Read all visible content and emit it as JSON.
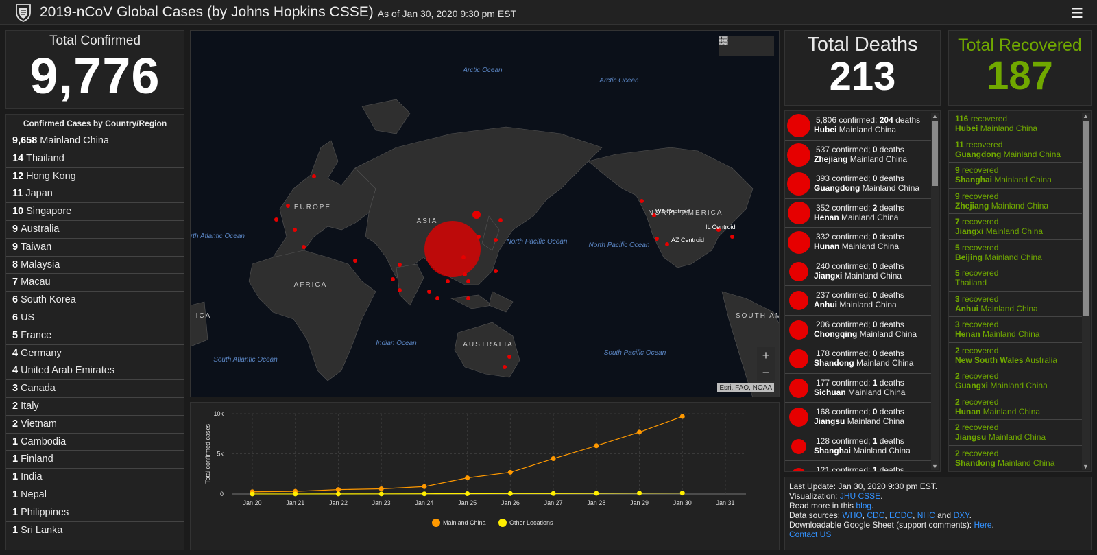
{
  "header": {
    "title": "2019-nCoV Global Cases (by Johns Hopkins CSSE)",
    "as_of": "As of Jan 30, 2020 9:30 pm EST"
  },
  "confirmed": {
    "label": "Total Confirmed",
    "value": "9,776"
  },
  "country_list": {
    "heading": "Confirmed Cases by Country/Region",
    "items": [
      {
        "count": "9,658",
        "name": "Mainland China"
      },
      {
        "count": "14",
        "name": "Thailand"
      },
      {
        "count": "12",
        "name": "Hong Kong"
      },
      {
        "count": "11",
        "name": "Japan"
      },
      {
        "count": "10",
        "name": "Singapore"
      },
      {
        "count": "9",
        "name": "Australia"
      },
      {
        "count": "9",
        "name": "Taiwan"
      },
      {
        "count": "8",
        "name": "Malaysia"
      },
      {
        "count": "7",
        "name": "Macau"
      },
      {
        "count": "6",
        "name": "South Korea"
      },
      {
        "count": "6",
        "name": "US"
      },
      {
        "count": "5",
        "name": "France"
      },
      {
        "count": "4",
        "name": "Germany"
      },
      {
        "count": "4",
        "name": "United Arab Emirates"
      },
      {
        "count": "3",
        "name": "Canada"
      },
      {
        "count": "2",
        "name": "Italy"
      },
      {
        "count": "2",
        "name": "Vietnam"
      },
      {
        "count": "1",
        "name": "Cambodia"
      },
      {
        "count": "1",
        "name": "Finland"
      },
      {
        "count": "1",
        "name": "India"
      },
      {
        "count": "1",
        "name": "Nepal"
      },
      {
        "count": "1",
        "name": "Philippines"
      },
      {
        "count": "1",
        "name": "Sri Lanka"
      }
    ]
  },
  "map": {
    "labels": {
      "arctic1": "Arctic Ocean",
      "arctic2": "Arctic Ocean",
      "north_atlantic": "North Atlantic Ocean",
      "north_pacific1": "North Pacific Ocean",
      "north_pacific2": "North Pacific Ocean",
      "indian": "Indian Ocean",
      "south_atlantic": "South Atlantic Ocean",
      "south_pacific": "South Pacific Ocean",
      "europe": "EUROPE",
      "asia": "ASIA",
      "africa": "AFRICA",
      "australia": "AUSTRALIA",
      "north_america": "NORTH AMERICA",
      "south_america": "SOUTH AMER",
      "africa_edge": "H ICA",
      "wa": "WA Centroid",
      "il": "IL Centroid",
      "az": "AZ Centroid"
    },
    "attribution": "Esri, FAO, NOAA",
    "zoom_in": "+",
    "zoom_out": "−",
    "icons": [
      "bookmark-icon",
      "list-icon",
      "grid-icon"
    ]
  },
  "chart_data": {
    "type": "line",
    "categories": [
      "Jan 20",
      "Jan 21",
      "Jan 22",
      "Jan 23",
      "Jan 24",
      "Jan 25",
      "Jan 26",
      "Jan 27",
      "Jan 28",
      "Jan 29",
      "Jan 30",
      "Jan 31"
    ],
    "series": [
      {
        "name": "Mainland China",
        "color": "#ff9900",
        "values": [
          278,
          326,
          547,
          639,
          916,
          2000,
          2700,
          4400,
          6000,
          7700,
          9658,
          null
        ]
      },
      {
        "name": "Other Locations",
        "color": "#ffee00",
        "values": [
          4,
          6,
          8,
          14,
          25,
          40,
          57,
          64,
          87,
          105,
          118,
          null
        ]
      }
    ],
    "ylabel": "Total confirmed cases",
    "yticks": [
      "0",
      "5k",
      "10k"
    ],
    "ylim": [
      0,
      10000
    ]
  },
  "deaths": {
    "label": "Total Deaths",
    "value": "213"
  },
  "recovered": {
    "label": "Total Recovered",
    "value": "187"
  },
  "province_list": [
    {
      "confirmed": "5,806",
      "deaths": "204",
      "province": "Hubei",
      "region": "Mainland China"
    },
    {
      "confirmed": "537",
      "deaths": "0",
      "province": "Zhejiang",
      "region": "Mainland China"
    },
    {
      "confirmed": "393",
      "deaths": "0",
      "province": "Guangdong",
      "region": "Mainland China"
    },
    {
      "confirmed": "352",
      "deaths": "2",
      "province": "Henan",
      "region": "Mainland China"
    },
    {
      "confirmed": "332",
      "deaths": "0",
      "province": "Hunan",
      "region": "Mainland China"
    },
    {
      "confirmed": "240",
      "deaths": "0",
      "province": "Jiangxi",
      "region": "Mainland China"
    },
    {
      "confirmed": "237",
      "deaths": "0",
      "province": "Anhui",
      "region": "Mainland China"
    },
    {
      "confirmed": "206",
      "deaths": "0",
      "province": "Chongqing",
      "region": "Mainland China"
    },
    {
      "confirmed": "178",
      "deaths": "0",
      "province": "Shandong",
      "region": "Mainland China"
    },
    {
      "confirmed": "177",
      "deaths": "1",
      "province": "Sichuan",
      "region": "Mainland China"
    },
    {
      "confirmed": "168",
      "deaths": "0",
      "province": "Jiangsu",
      "region": "Mainland China"
    },
    {
      "confirmed": "128",
      "deaths": "1",
      "province": "Shanghai",
      "region": "Mainland China"
    },
    {
      "confirmed": "121",
      "deaths": "1",
      "province": "",
      "region": ""
    }
  ],
  "recovered_list": [
    {
      "count": "116",
      "province": "Hubei",
      "region": "Mainland China"
    },
    {
      "count": "11",
      "province": "Guangdong",
      "region": "Mainland China"
    },
    {
      "count": "9",
      "province": "Shanghai",
      "region": "Mainland China"
    },
    {
      "count": "9",
      "province": "Zhejiang",
      "region": "Mainland China"
    },
    {
      "count": "7",
      "province": "Jiangxi",
      "region": "Mainland China"
    },
    {
      "count": "5",
      "province": "Beijing",
      "region": "Mainland China"
    },
    {
      "count": "5",
      "province": "",
      "region": "Thailand"
    },
    {
      "count": "3",
      "province": "Anhui",
      "region": "Mainland China"
    },
    {
      "count": "3",
      "province": "Henan",
      "region": "Mainland China"
    },
    {
      "count": "2",
      "province": "New South Wales",
      "region": "Australia"
    },
    {
      "count": "2",
      "province": "Guangxi",
      "region": "Mainland China"
    },
    {
      "count": "2",
      "province": "Hunan",
      "region": "Mainland China"
    },
    {
      "count": "2",
      "province": "Jiangsu",
      "region": "Mainland China"
    },
    {
      "count": "2",
      "province": "Shandong",
      "region": "Mainland China"
    }
  ],
  "info": {
    "last_update": "Last Update: Jan 30, 2020 9:30 pm EST.",
    "visualization_prefix": "Visualization: ",
    "visualization_link": "JHU CSSE",
    "read_more_prefix": "Read more in this ",
    "read_more_link": "blog",
    "sources_prefix": "Data sources: ",
    "sources": [
      "WHO",
      "CDC",
      "ECDC",
      "NHC",
      "DXY"
    ],
    "sheet_prefix": "Downloadable Google Sheet (support comments): ",
    "sheet_link": "Here",
    "contact_link": "Contact US"
  },
  "colors": {
    "accent_red": "#e60000",
    "recovered_green": "#70a800",
    "link_blue": "#3392ff"
  }
}
